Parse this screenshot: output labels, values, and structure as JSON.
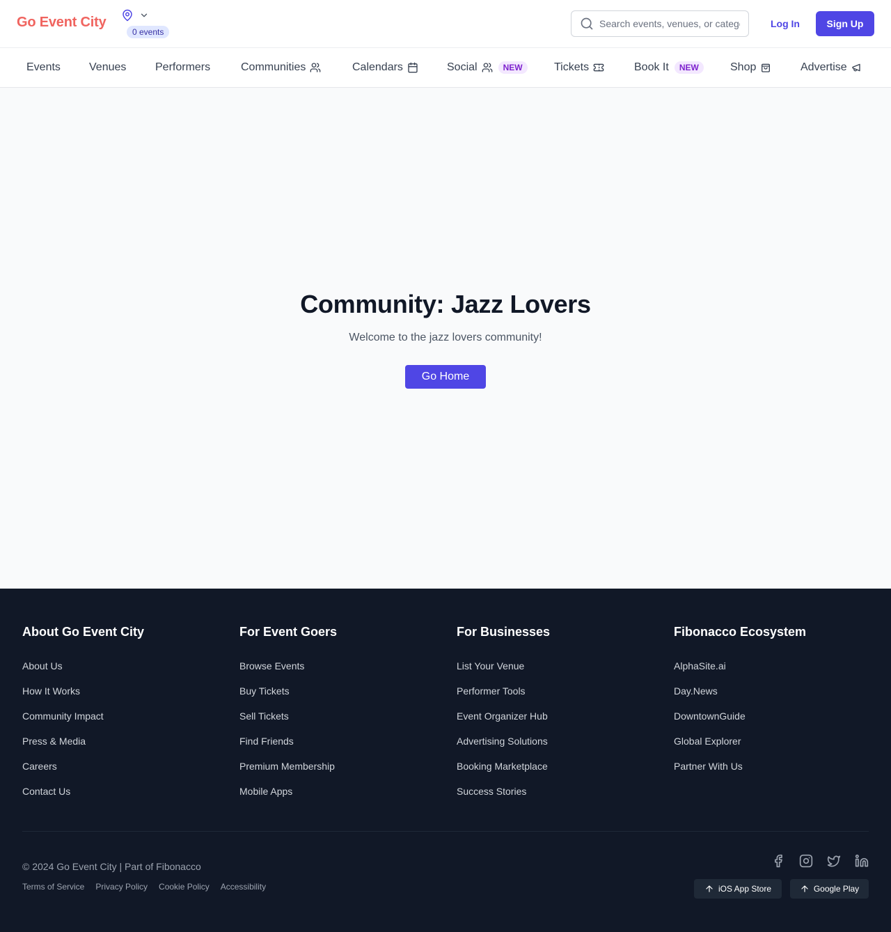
{
  "header": {
    "brand": "Go Event City",
    "location_count": "0 events",
    "search_placeholder": "Search events, venues, or categories...",
    "login_label": "Log In",
    "signup_label": "Sign Up"
  },
  "nav": {
    "items": [
      {
        "label": "Events"
      },
      {
        "label": "Venues"
      },
      {
        "label": "Performers"
      },
      {
        "label": "Communities",
        "icon": "users-icon"
      },
      {
        "label": "Calendars",
        "icon": "calendar-icon"
      },
      {
        "label": "Social",
        "icon": "users-icon",
        "badge": "NEW"
      },
      {
        "label": "Tickets",
        "icon": "ticket-icon"
      },
      {
        "label": "Book It",
        "badge": "NEW"
      },
      {
        "label": "Shop",
        "icon": "shopping-bag-icon"
      },
      {
        "label": "Advertise",
        "icon": "megaphone-icon"
      }
    ]
  },
  "main": {
    "title": "Community: Jazz Lovers",
    "subtitle": "Welcome to the jazz lovers community!",
    "button_label": "Go Home"
  },
  "footer": {
    "columns": [
      {
        "title": "About Go Event City",
        "links": [
          "About Us",
          "How It Works",
          "Community Impact",
          "Press & Media",
          "Careers",
          "Contact Us"
        ]
      },
      {
        "title": "For Event Goers",
        "links": [
          "Browse Events",
          "Buy Tickets",
          "Sell Tickets",
          "Find Friends",
          "Premium Membership",
          "Mobile Apps"
        ]
      },
      {
        "title": "For Businesses",
        "links": [
          "List Your Venue",
          "Performer Tools",
          "Event Organizer Hub",
          "Advertising Solutions",
          "Booking Marketplace",
          "Success Stories"
        ]
      },
      {
        "title": "Fibonacco Ecosystem",
        "links": [
          "AlphaSite.ai",
          "Day.News",
          "DowntownGuide",
          "Global Explorer",
          "Partner With Us"
        ]
      }
    ],
    "copyright": "© 2024 Go Event City | Part of Fibonacco",
    "legal": [
      "Terms of Service",
      "Privacy Policy",
      "Cookie Policy",
      "Accessibility"
    ],
    "socials": [
      "facebook-icon",
      "instagram-icon",
      "twitter-icon",
      "linkedin-icon"
    ],
    "store_buttons": [
      "iOS App Store",
      "Google Play"
    ]
  },
  "colors": {
    "brand": "#f0645f",
    "accent": "#4f46e5",
    "footer_bg": "#111827",
    "new_badge_bg": "#f3e8ff",
    "new_badge_text": "#7e22ce"
  }
}
